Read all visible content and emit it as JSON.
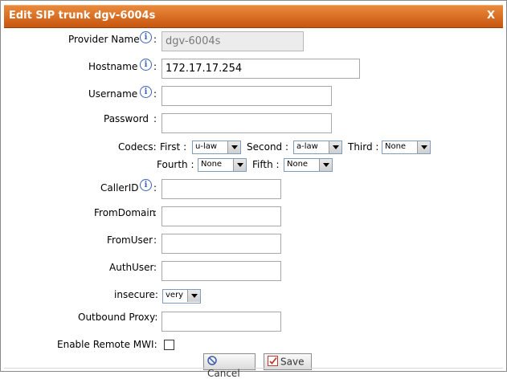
{
  "dialog": {
    "title": "Edit SIP trunk dgv-6004s",
    "close_label": "X"
  },
  "fields": {
    "provider_name": {
      "label": "Provider Name",
      "value": "dgv-6004s"
    },
    "hostname": {
      "label": "Hostname",
      "value": "172.17.17.254"
    },
    "username": {
      "label": "Username",
      "value": ""
    },
    "password": {
      "label": "Password",
      "value": ""
    },
    "callerid": {
      "label": "CallerID",
      "value": ""
    },
    "fromdomain": {
      "label": "FromDomain",
      "value": ""
    },
    "fromuser": {
      "label": "FromUser",
      "value": ""
    },
    "authuser": {
      "label": "AuthUser",
      "value": ""
    },
    "insecure": {
      "label": "insecure:",
      "value": "very"
    },
    "outbound_proxy": {
      "label": "Outbound Proxy:",
      "value": ""
    },
    "remote_mwi": {
      "label": "Enable Remote MWI:",
      "checked": false
    }
  },
  "codecs": {
    "label": "Codecs:",
    "first": {
      "label": "First :",
      "value": "u-law"
    },
    "second": {
      "label": "Second :",
      "value": "a-law"
    },
    "third": {
      "label": "Third :",
      "value": "None"
    },
    "fourth": {
      "label": "Fourth :",
      "value": "None"
    },
    "fifth": {
      "label": "Fifth :",
      "value": "None"
    }
  },
  "buttons": {
    "cancel": "Cancel",
    "save": "Save"
  },
  "colors": {
    "title_bar": "#d96c22",
    "info_icon": "#3a63b8"
  },
  "icons": {
    "info": "info-icon",
    "cancel": "cancel-icon",
    "save": "save-check-icon"
  }
}
